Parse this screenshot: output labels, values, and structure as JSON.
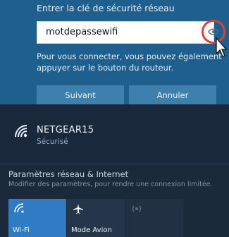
{
  "prompt": {
    "label": "Entrer la clé de sécurité réseau"
  },
  "password_field": {
    "value": "motdepassewifi",
    "reveal_icon": "eye-icon"
  },
  "hint": {
    "text": "Pour vous connecter, vous pouvez également appuyer sur le bouton du routeur."
  },
  "buttons": {
    "next": "Suivant",
    "cancel": "Annuler"
  },
  "network": {
    "name": "NETGEAR15",
    "status": "Sécurisé",
    "icon": "wifi-icon"
  },
  "settings": {
    "link": "Paramètres réseau & Internet",
    "description": "Modifier des paramètres, pour rendre une connexion limitée."
  },
  "quick_actions": [
    {
      "label": "Wi-Fi",
      "icon": "wifi-icon",
      "active": true
    },
    {
      "label": "Mode Avion",
      "icon": "airplane-icon",
      "active": false
    },
    {
      "label": "",
      "icon": "hotspot-icon",
      "active": false
    }
  ],
  "colors": {
    "accent": "#2f7cc4",
    "panel": "#1f5f8e",
    "highlight_ring": "#d8442f"
  }
}
